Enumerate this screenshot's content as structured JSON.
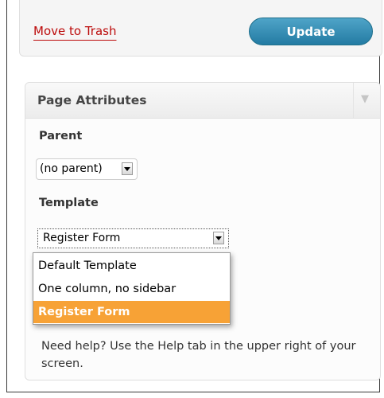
{
  "publish": {
    "trash_label": "Move to Trash",
    "update_label": "Update"
  },
  "page_attributes": {
    "title": "Page Attributes",
    "toggle_icon": "triangle-down-icon",
    "parent": {
      "label": "Parent",
      "selected": "(no parent)"
    },
    "template": {
      "label": "Template",
      "selected": "Register Form",
      "options": [
        "Default Template",
        "One column, no sidebar",
        "Register Form"
      ],
      "highlighted_index": 2
    },
    "help_text": "Need help? Use the Help tab in the upper right of your screen."
  },
  "colors": {
    "trash_link": "#bc0b0b",
    "update_button": "#2e88b0",
    "dropdown_highlight": "#f7a236"
  }
}
